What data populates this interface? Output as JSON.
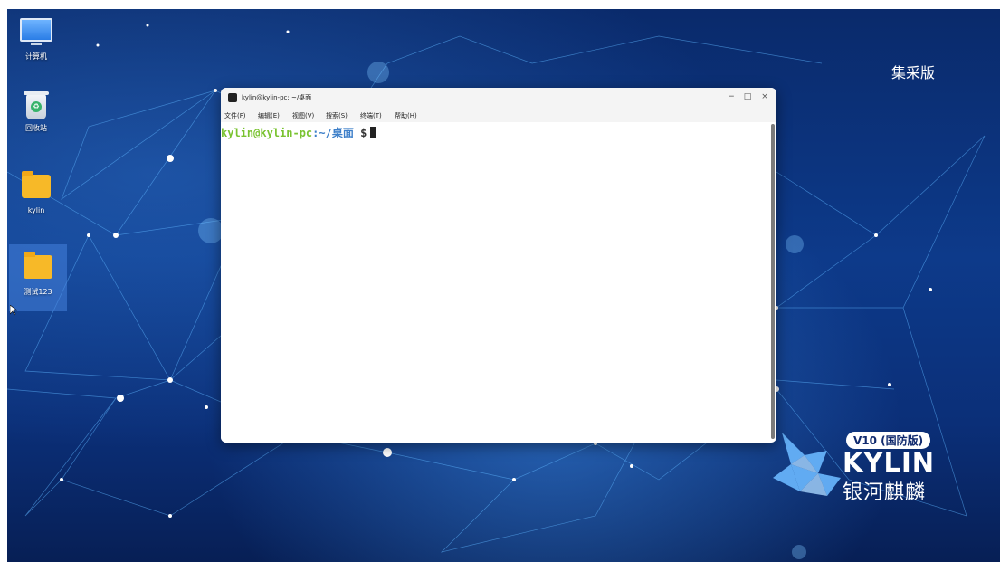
{
  "desktop": {
    "icons": [
      {
        "label": "计算机",
        "icon": "computer-icon"
      },
      {
        "label": "回收站",
        "icon": "trash-icon"
      },
      {
        "label": "kylin",
        "icon": "folder-icon"
      },
      {
        "label": "测试123",
        "icon": "folder-icon"
      }
    ],
    "edition_label": "集采版",
    "logo": {
      "badge": "V10 (国防版)",
      "brand": "KYLIN",
      "brand_cn": "银河麒麟"
    },
    "colors": {
      "background": "#0b2f78",
      "accent": "#f7b928"
    }
  },
  "terminal": {
    "title": "kylin@kylin-pc: ~/桌面",
    "window_controls": {
      "minimize": "−",
      "maximize": "□",
      "close": "×"
    },
    "menu": [
      "文件(F)",
      "编辑(E)",
      "视图(V)",
      "搜索(S)",
      "终端(T)",
      "帮助(H)"
    ],
    "prompt": {
      "user_host": "kylin@kylin-pc",
      "separator": ":",
      "path": "~/桌面",
      "symbol": "$"
    }
  }
}
